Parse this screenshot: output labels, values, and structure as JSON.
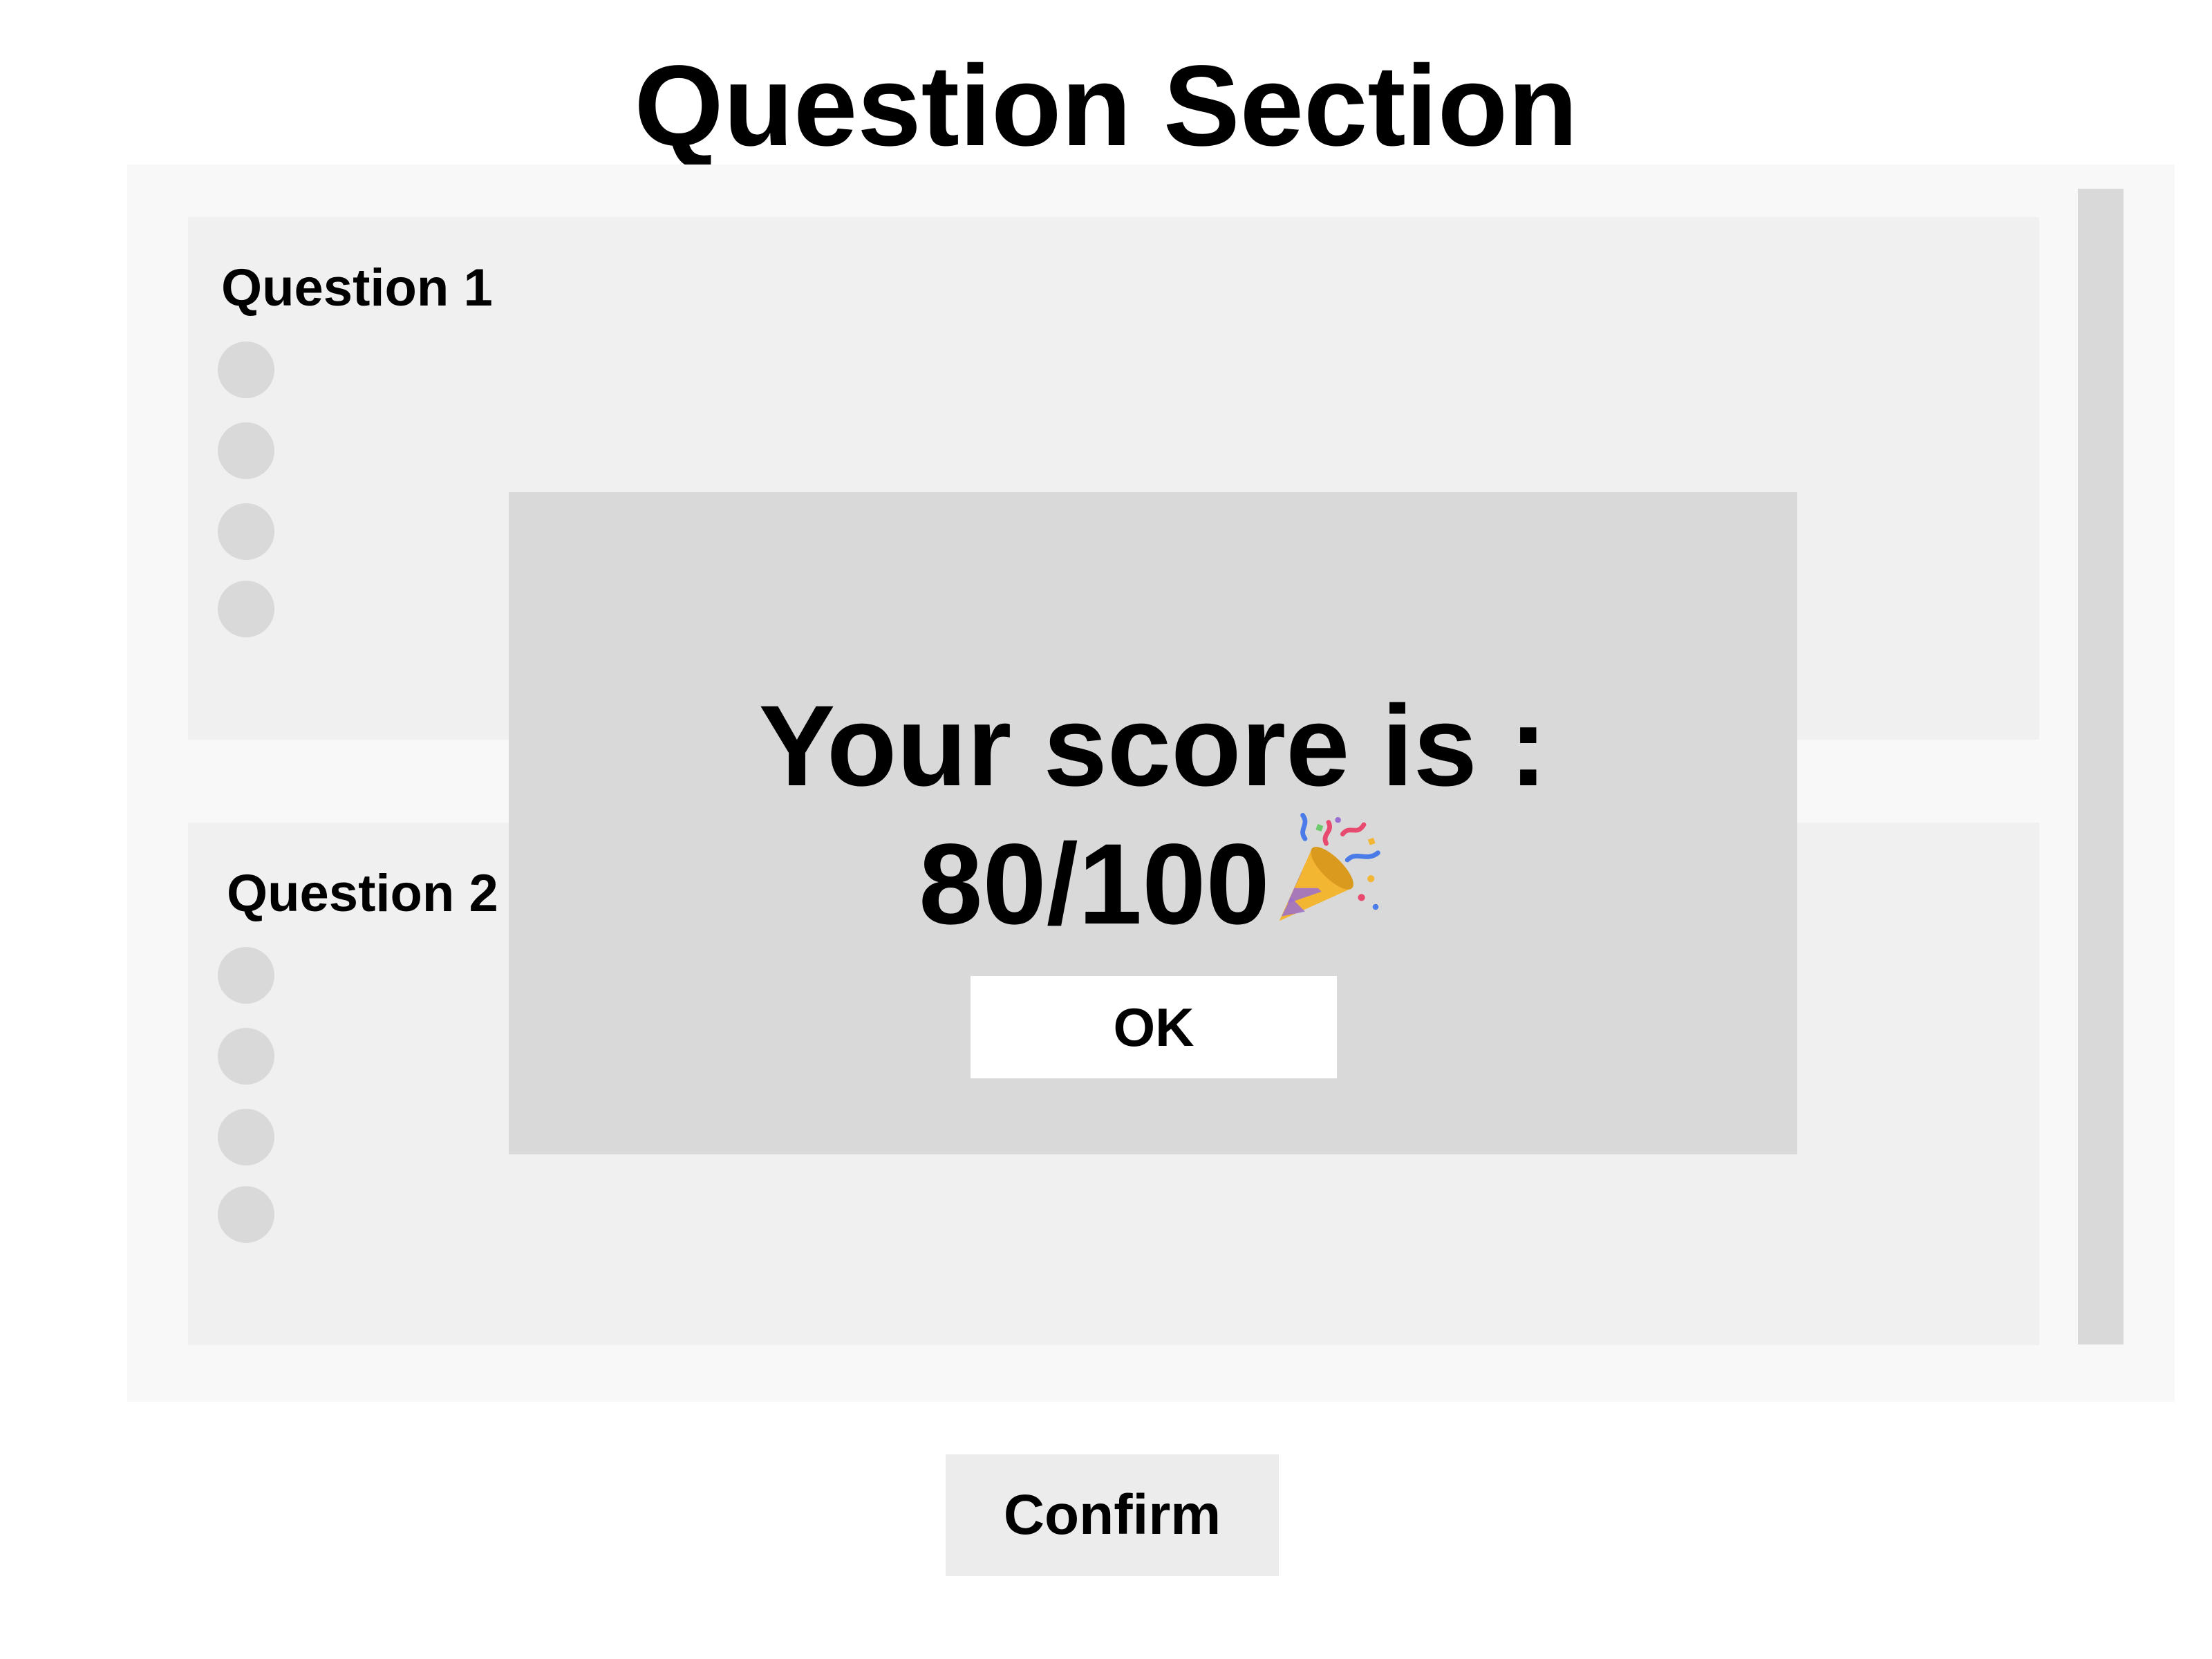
{
  "page": {
    "title": "Question Section"
  },
  "questions": [
    {
      "label": "Question 1",
      "option_count": 4
    },
    {
      "label": "Question 2",
      "option_count": 4
    }
  ],
  "actions": {
    "confirm_label": "Confirm"
  },
  "score_modal": {
    "line1": "Your score is :",
    "score": "80/100",
    "icon": "party-popper-icon",
    "ok_label": "OK"
  },
  "colors": {
    "panel_bg": "#f8f8f8",
    "card_bg": "#f0f0f0",
    "radio": "#d9d9d9",
    "modal_bg": "#d9d9d9",
    "button_bg": "#ececec"
  }
}
